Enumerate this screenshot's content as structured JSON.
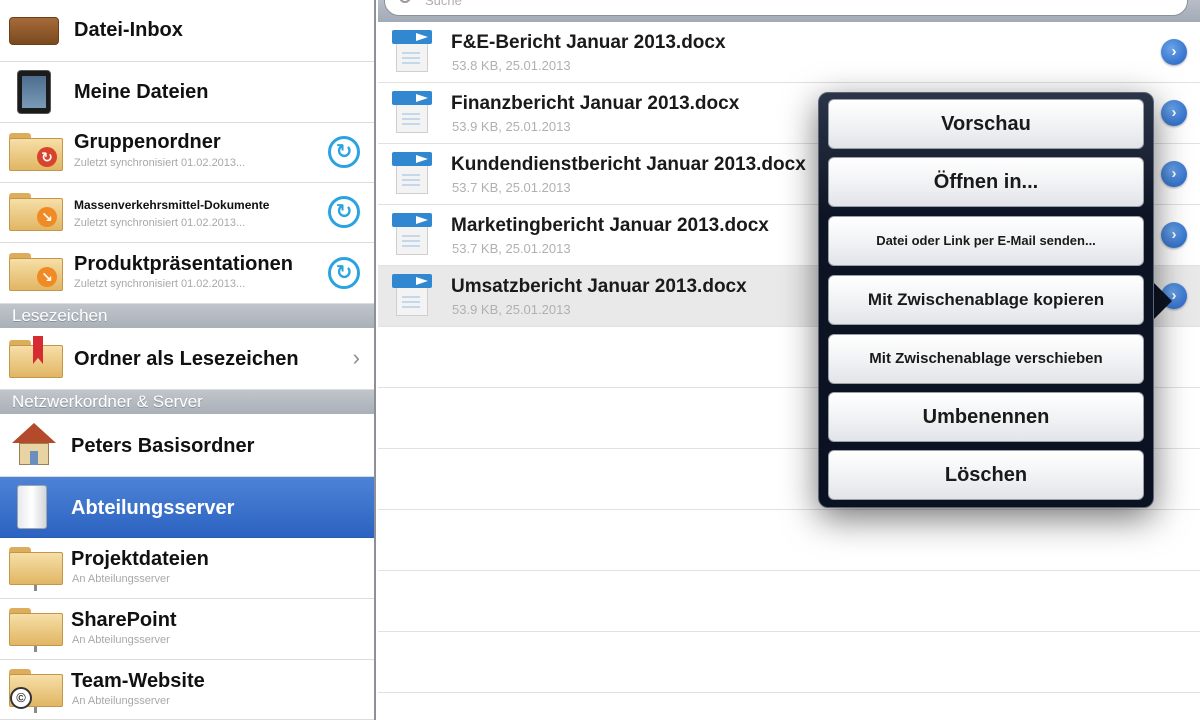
{
  "sidebar": {
    "items": [
      {
        "label": "Datei-Inbox",
        "sub": ""
      },
      {
        "label": "Meine Dateien",
        "sub": ""
      },
      {
        "label": "Gruppenordner",
        "sub": "Zuletzt synchronisiert 01.02.2013..."
      },
      {
        "label": "Massenverkehrsmittel-Dokumente",
        "sub": "Zuletzt synchronisiert 01.02.2013..."
      },
      {
        "label": "Produktpräsentationen",
        "sub": "Zuletzt synchronisiert 01.02.2013..."
      },
      {
        "label": "Ordner als Lesezeichen",
        "sub": ""
      },
      {
        "label": "Peters Basisordner",
        "sub": ""
      },
      {
        "label": "Abteilungsserver",
        "sub": ""
      },
      {
        "label": "Projektdateien",
        "sub": "An Abteilungsserver"
      },
      {
        "label": "SharePoint",
        "sub": "An Abteilungsserver"
      },
      {
        "label": "Team-Website",
        "sub": "An Abteilungsserver"
      }
    ],
    "sections": {
      "bookmarks": "Lesezeichen",
      "network": "Netzwerkordner & Server"
    },
    "sync_glyph": "↻",
    "chevron_glyph": "›",
    "copyright": "©"
  },
  "search": {
    "placeholder": "Suche"
  },
  "files": [
    {
      "name": "F&E-Bericht Januar 2013.docx",
      "meta": "53.8 KB, 25.01.2013"
    },
    {
      "name": "Finanzbericht Januar 2013.docx",
      "meta": "53.9 KB, 25.01.2013"
    },
    {
      "name": "Kundendienstbericht Januar 2013.docx",
      "meta": "53.7 KB, 25.01.2013"
    },
    {
      "name": "Marketingbericht Januar 2013.docx",
      "meta": "53.7 KB, 25.01.2013"
    },
    {
      "name": "Umsatzbericht Januar 2013.docx",
      "meta": "53.9 KB, 25.01.2013"
    }
  ],
  "disclosure_glyph": "›",
  "popover": {
    "actions": [
      "Vorschau",
      "Öffnen in...",
      "Datei oder Link per E-Mail senden...",
      "Mit Zwischenablage kopieren",
      "Mit Zwischenablage verschieben",
      "Umbenennen",
      "Löschen"
    ]
  },
  "colors": {
    "selected_sidebar": "#3a72cd",
    "sync_accent": "#2aa3e0",
    "disclosure_blue": "#1f5fc2",
    "popover_bg": "#0d1424"
  }
}
